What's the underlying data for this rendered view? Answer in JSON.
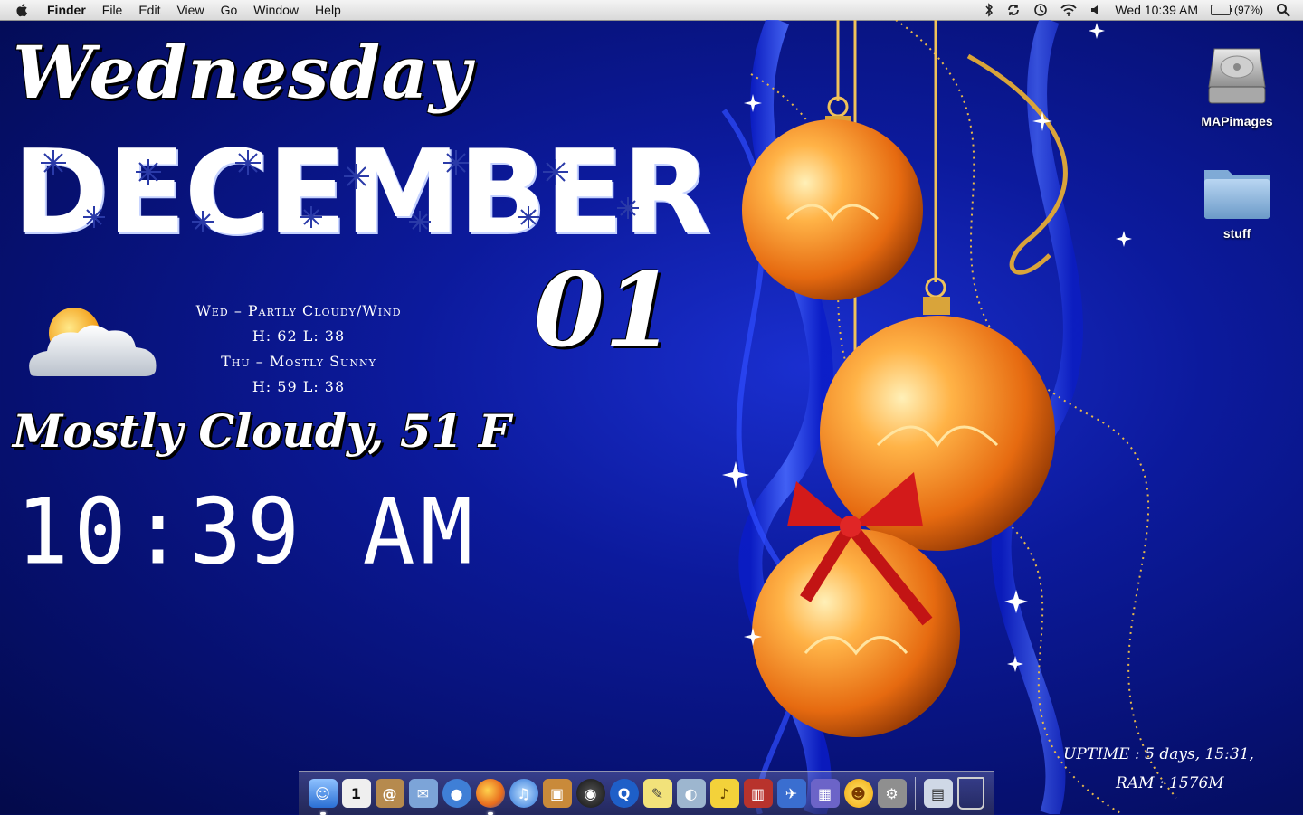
{
  "menubar": {
    "app_name": "Finder",
    "menus": [
      "File",
      "Edit",
      "View",
      "Go",
      "Window",
      "Help"
    ],
    "clock": "Wed 10:39 AM",
    "battery": "(97%)"
  },
  "widgets": {
    "day": "Wednesday",
    "month": "DECEMBER",
    "date": "01",
    "forecast": {
      "line1": "Wed – Partly Cloudy/Wind",
      "line2": "H: 62  L: 38",
      "line3": "Thu – Mostly Sunny",
      "line4": "H: 59  L: 38"
    },
    "current": "Mostly Cloudy, 51 F",
    "time": "10:39 AM",
    "uptime": "UPTIME : 5 days, 15:31,",
    "ram": "RAM : 1576M"
  },
  "desktop_icons": [
    {
      "label": "MAPimages",
      "icon": "hard-drive-icon"
    },
    {
      "label": "stuff",
      "icon": "folder-icon"
    }
  ],
  "dock": {
    "apps": [
      {
        "name": "finder-icon",
        "color": "#4a8fe0",
        "running": true
      },
      {
        "name": "ical-icon",
        "color": "#e9e9e9"
      },
      {
        "name": "address-book-icon",
        "color": "#b68a4e"
      },
      {
        "name": "mail-icon",
        "color": "#7ca4d8"
      },
      {
        "name": "ichat-icon",
        "color": "#3f7fd6"
      },
      {
        "name": "firefox-icon",
        "color": "#e86b1d",
        "running": true
      },
      {
        "name": "itunes-icon",
        "color": "#2e74d8"
      },
      {
        "name": "iphoto-icon",
        "color": "#c98a3a"
      },
      {
        "name": "dvd-player-icon",
        "color": "#222222"
      },
      {
        "name": "quicktime-icon",
        "color": "#1e5fc8"
      },
      {
        "name": "stickies-icon",
        "color": "#f2e27a"
      },
      {
        "name": "preview-icon",
        "color": "#9db6cf"
      },
      {
        "name": "cyberduck-icon",
        "color": "#f3d23a"
      },
      {
        "name": "photo-booth-icon",
        "color": "#b8332c"
      },
      {
        "name": "transmit-icon",
        "color": "#3a6ed0"
      },
      {
        "name": "spaces-icon",
        "color": "#6c64c8"
      },
      {
        "name": "adium-icon",
        "color": "#f6c21b"
      },
      {
        "name": "system-preferences-icon",
        "color": "#8f8f8f"
      }
    ],
    "right": [
      {
        "name": "documents-stack-icon",
        "color": "#cfd8e6"
      },
      {
        "name": "trash-icon",
        "color": "#b9b9b9"
      }
    ]
  }
}
